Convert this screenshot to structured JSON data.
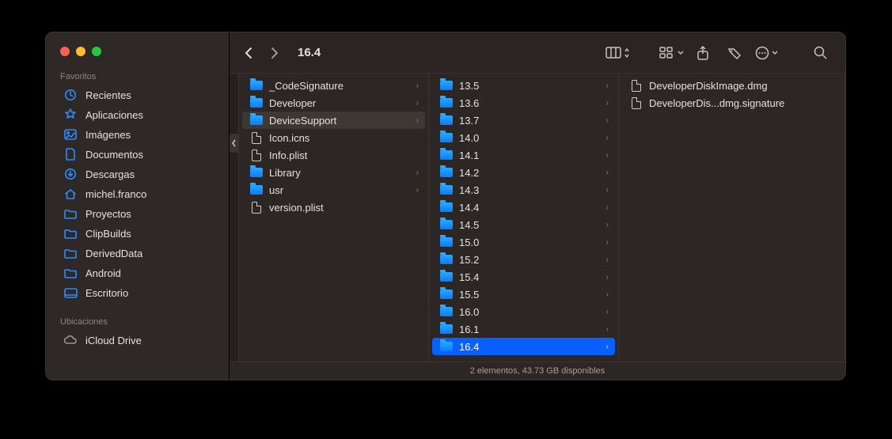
{
  "window": {
    "title": "16.4"
  },
  "sidebar": {
    "sections": [
      {
        "title": "Favoritos",
        "items": [
          {
            "label": "Recientes",
            "icon": "clock"
          },
          {
            "label": "Aplicaciones",
            "icon": "apps"
          },
          {
            "label": "Imágenes",
            "icon": "image"
          },
          {
            "label": "Documentos",
            "icon": "doc"
          },
          {
            "label": "Descargas",
            "icon": "download"
          },
          {
            "label": "michel.franco",
            "icon": "home"
          },
          {
            "label": "Proyectos",
            "icon": "folder"
          },
          {
            "label": "ClipBuilds",
            "icon": "folder"
          },
          {
            "label": "DerivedData",
            "icon": "folder"
          },
          {
            "label": "Android",
            "icon": "folder"
          },
          {
            "label": "Escritorio",
            "icon": "desktop"
          }
        ]
      },
      {
        "title": "Ubicaciones",
        "items": [
          {
            "label": "iCloud Drive",
            "icon": "cloud"
          }
        ]
      }
    ]
  },
  "columns": [
    {
      "items": [
        {
          "label": "_CodeSignature",
          "type": "folder"
        },
        {
          "label": "Developer",
          "type": "folder"
        },
        {
          "label": "DeviceSupport",
          "type": "folder",
          "selected": true
        },
        {
          "label": "Icon.icns",
          "type": "file-dark"
        },
        {
          "label": "Info.plist",
          "type": "file"
        },
        {
          "label": "Library",
          "type": "folder"
        },
        {
          "label": "usr",
          "type": "folder"
        },
        {
          "label": "version.plist",
          "type": "file"
        }
      ]
    },
    {
      "items": [
        {
          "label": "13.5",
          "type": "folder"
        },
        {
          "label": "13.6",
          "type": "folder"
        },
        {
          "label": "13.7",
          "type": "folder"
        },
        {
          "label": "14.0",
          "type": "folder"
        },
        {
          "label": "14.1",
          "type": "folder"
        },
        {
          "label": "14.2",
          "type": "folder"
        },
        {
          "label": "14.3",
          "type": "folder"
        },
        {
          "label": "14.4",
          "type": "folder"
        },
        {
          "label": "14.5",
          "type": "folder"
        },
        {
          "label": "15.0",
          "type": "folder"
        },
        {
          "label": "15.2",
          "type": "folder"
        },
        {
          "label": "15.4",
          "type": "folder"
        },
        {
          "label": "15.5",
          "type": "folder"
        },
        {
          "label": "16.0",
          "type": "folder"
        },
        {
          "label": "16.1",
          "type": "folder"
        },
        {
          "label": "16.4",
          "type": "folder",
          "selectedBlue": true
        }
      ]
    },
    {
      "items": [
        {
          "label": "DeveloperDiskImage.dmg",
          "type": "file"
        },
        {
          "label": "DeveloperDis...dmg.signature",
          "type": "file"
        }
      ]
    }
  ],
  "status": "2 elementos, 43.73 GB disponibles"
}
